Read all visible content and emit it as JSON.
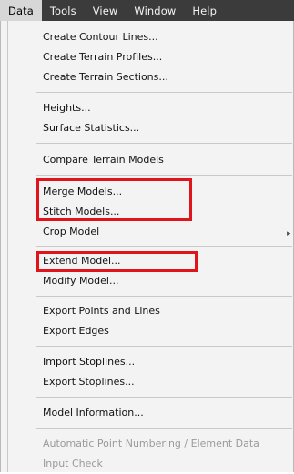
{
  "menubar": {
    "items": [
      {
        "label": "Data"
      },
      {
        "label": "Tools"
      },
      {
        "label": "View"
      },
      {
        "label": "Window"
      },
      {
        "label": "Help"
      }
    ],
    "active": "Data"
  },
  "menu": {
    "items": [
      {
        "label": "Create Contour Lines..."
      },
      {
        "label": "Create Terrain Profiles..."
      },
      {
        "label": "Create Terrain Sections..."
      },
      {
        "label": "Heights..."
      },
      {
        "label": "Surface Statistics..."
      },
      {
        "label": "Compare Terrain Models"
      },
      {
        "label": "Merge Models..."
      },
      {
        "label": "Stitch Models..."
      },
      {
        "label": "Crop Model"
      },
      {
        "label": "Extend Model..."
      },
      {
        "label": "Modify Model..."
      },
      {
        "label": "Export Points and Lines"
      },
      {
        "label": "Export Edges"
      },
      {
        "label": "Import Stoplines..."
      },
      {
        "label": "Export Stoplines..."
      },
      {
        "label": "Model Information..."
      },
      {
        "label": "Automatic Point Numbering / Element Data",
        "disabled": true
      },
      {
        "label": "Input Check",
        "disabled": true
      }
    ]
  },
  "colors": {
    "menubar_bg": "#3b3b3b",
    "highlight_outline": "#e0141b",
    "disabled_text": "#9a9a9a"
  }
}
